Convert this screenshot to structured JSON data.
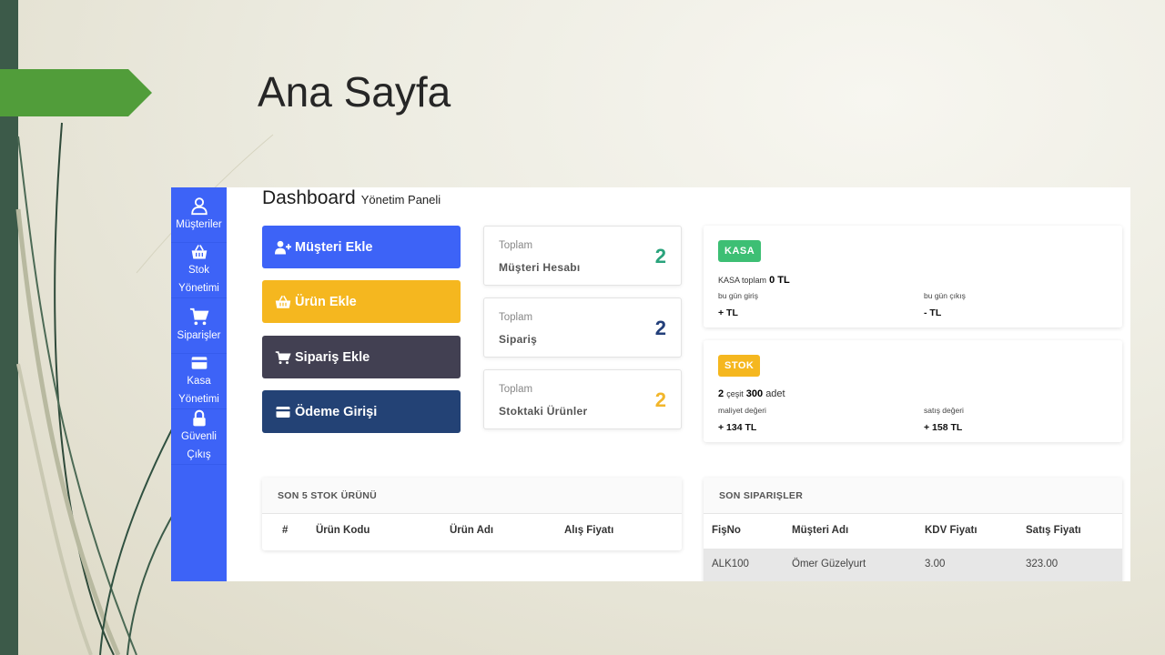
{
  "slide": {
    "title": "Ana Sayfa"
  },
  "sidebar": {
    "items": [
      {
        "label": "Müşteriler",
        "icon": "user-icon"
      },
      {
        "label": "Stok Yönetimi",
        "icon": "basket-icon"
      },
      {
        "label": "Siparişler",
        "icon": "cart-icon"
      },
      {
        "label": "Kasa Yönetimi",
        "icon": "credit-card-icon"
      },
      {
        "label": "Güvenli Çıkış",
        "icon": "lock-icon"
      }
    ]
  },
  "header": {
    "title": "Dashboard",
    "subtitle": "Yönetim Paneli"
  },
  "actions": {
    "add_customer": "Müşteri Ekle",
    "add_product": "Ürün Ekle",
    "add_order": "Sipariş Ekle",
    "payment": "Ödeme Girişi"
  },
  "stats": [
    {
      "caption": "Toplam",
      "name": "Müşteri Hesabı",
      "value": "2",
      "color": "#2aa37c"
    },
    {
      "caption": "Toplam",
      "name": "Sipariş",
      "value": "2",
      "color": "#233f7a"
    },
    {
      "caption": "Toplam",
      "name": "Stoktaki Ürünler",
      "value": "2",
      "color": "#f2b62b"
    }
  ],
  "kasa": {
    "badge": "KASA",
    "total_prefix": "KASA toplam",
    "total_value": "0 TL",
    "in_label": "bu gün giriş",
    "out_label": "bu gün çıkış",
    "in_value": "+ TL",
    "out_value": "- TL"
  },
  "stok": {
    "badge": "STOK",
    "count": "2",
    "count_label": "çeşit",
    "qty": "300",
    "qty_label": "adet",
    "cost_label": "maliyet değeri",
    "sale_label": "satış değeri",
    "cost_value": "+ 134 TL",
    "sale_value": "+ 158 TL"
  },
  "stock_table": {
    "title": "SON 5 STOK ÜRÜNÜ",
    "columns": [
      "#",
      "Ürün Kodu",
      "Ürün Adı",
      "Alış Fiyatı"
    ]
  },
  "orders_table": {
    "title": "SON SIPARIŞLER",
    "columns": [
      "FişNo",
      "Müşteri Adı",
      "KDV Fiyatı",
      "Satış Fiyatı"
    ],
    "rows": [
      [
        "ALK100",
        "Ömer Güzelyurt",
        "3.00",
        "323.00"
      ]
    ]
  },
  "colors": {
    "primary": "#3d63f7",
    "warning": "#f5b71f",
    "dark": "#424052",
    "navy": "#234275",
    "success": "#3dbf74",
    "slide_accent": "#4e9a3a"
  }
}
